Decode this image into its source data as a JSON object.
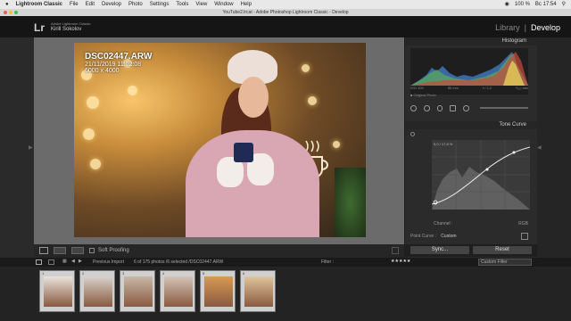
{
  "menubar": {
    "app": "Lightroom Classic",
    "items": [
      "File",
      "Edit",
      "Develop",
      "Photo",
      "Settings",
      "Tools",
      "View",
      "Window",
      "Help"
    ],
    "battery": "100 %",
    "clock": "Вс 17:54"
  },
  "window": {
    "title": "YouTube2.lrcat - Adobe Photoshop Lightroom Classic - Develop"
  },
  "identity": {
    "logo": "Lr",
    "app": "Adobe Lightroom Classic",
    "user": "Kirill Sokolov"
  },
  "modules": {
    "library": "Library",
    "separator": "|",
    "develop": "Develop"
  },
  "photo_info": {
    "filename": "DSC02447.ARW",
    "datetime": "21/11/2019 11:02:08",
    "dimensions": "6000 x 4000"
  },
  "toolbar": {
    "soft_proofing": "Soft Proofing"
  },
  "histogram": {
    "title": "Histogram",
    "iso": "ISO 100",
    "focal": "85 mm",
    "aperture": "f / 1,2",
    "shutter": "¹⁄₁₀₀ sec",
    "original_photo": "Original Photo"
  },
  "tone_curve": {
    "title": "Tone Curve",
    "readout": "5,0 / 17,8 %",
    "channel_label": "Channel :",
    "channel_value": "RGB",
    "point_curve_label": "Point Curve :",
    "point_curve_value": "Custom"
  },
  "buttons": {
    "sync": "Sync...",
    "reset": "Reset"
  },
  "filmbar": {
    "source": "Previous Import",
    "count": "6 of 175 photos /6 selected /DSC02447.ARW",
    "filter_label": "Filter :",
    "filter_value": "Custom Filter"
  },
  "filmstrip": {
    "thumbs": [
      {
        "num": "1",
        "tone": "#e9e3dc"
      },
      {
        "num": "2",
        "tone": "#d8d2cc"
      },
      {
        "num": "3",
        "tone": "#c7b8a7"
      },
      {
        "num": "4",
        "tone": "#d3c3b6"
      },
      {
        "num": "5",
        "tone": "#d79a56"
      },
      {
        "num": "6",
        "tone": "#e0c59d"
      }
    ]
  },
  "colors": {
    "accent": "#ffffff",
    "panel": "#2b2b2b",
    "viewer_bg": "#6b6b6b"
  }
}
